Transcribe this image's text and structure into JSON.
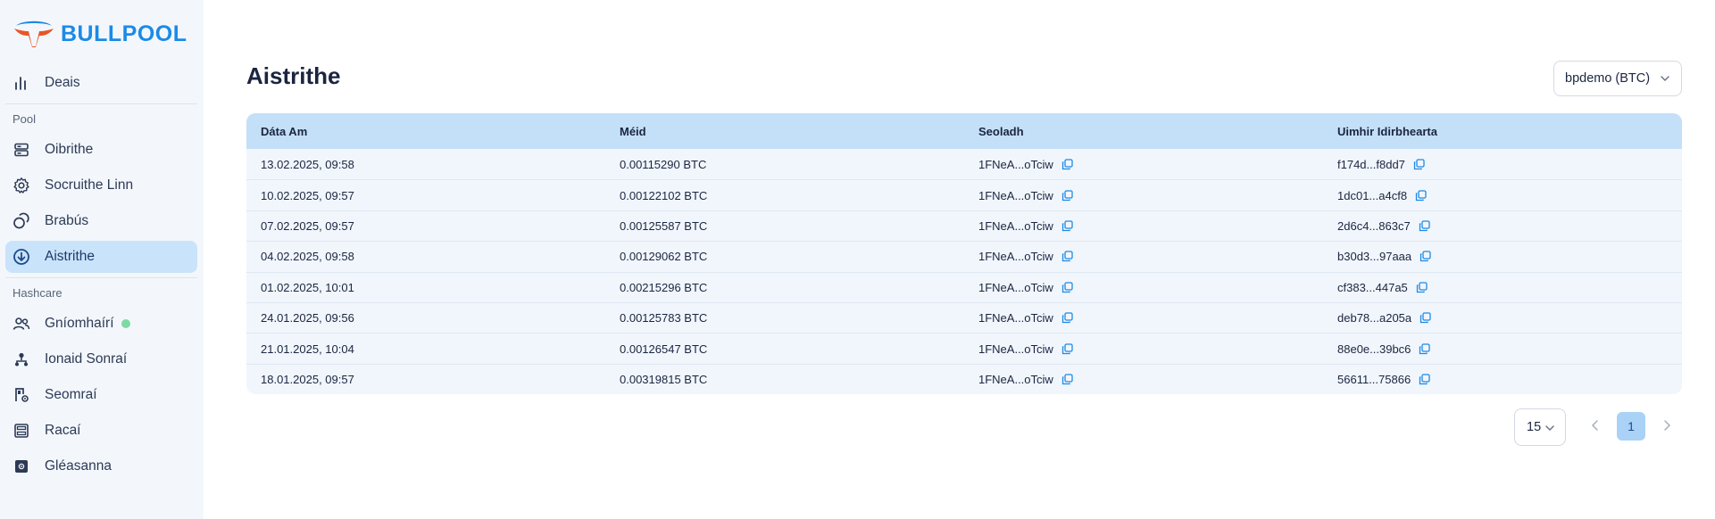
{
  "brand": {
    "name": "BULLPOOL"
  },
  "sidebar": {
    "top_item": {
      "label": "Deais",
      "icon": "bar-chart-icon"
    },
    "sections": [
      {
        "label": "Pool",
        "items": [
          {
            "label": "Oibrithe",
            "icon": "server-icon"
          },
          {
            "label": "Socruithe Linn",
            "icon": "gear-icon"
          },
          {
            "label": "Brabús",
            "icon": "coins-icon"
          },
          {
            "label": "Aistrithe",
            "icon": "arrow-down-circle-icon",
            "active": true
          }
        ]
      },
      {
        "label": "Hashcare",
        "items": [
          {
            "label": "Gníomhaírí",
            "icon": "users-icon",
            "status": "online"
          },
          {
            "label": "Ionaid Sonraí",
            "icon": "network-icon"
          },
          {
            "label": "Seomraí",
            "icon": "room-settings-icon"
          },
          {
            "label": "Racaí",
            "icon": "rack-icon"
          },
          {
            "label": "Gléasanna",
            "icon": "chip-icon"
          }
        ]
      }
    ]
  },
  "main": {
    "title": "Aistrithe",
    "account_selector": "bpdemo (BTC)",
    "table": {
      "columns": [
        "Dáta Am",
        "Méid",
        "Seoladh",
        "Uimhir Idirbhearta"
      ],
      "rows": [
        {
          "date": "13.02.2025, 09:58",
          "amount": "0.00115290 BTC",
          "address": "1FNeA...oTciw",
          "txid": "f174d...f8dd7"
        },
        {
          "date": "10.02.2025, 09:57",
          "amount": "0.00122102 BTC",
          "address": "1FNeA...oTciw",
          "txid": "1dc01...a4cf8"
        },
        {
          "date": "07.02.2025, 09:57",
          "amount": "0.00125587 BTC",
          "address": "1FNeA...oTciw",
          "txid": "2d6c4...863c7"
        },
        {
          "date": "04.02.2025, 09:58",
          "amount": "0.00129062 BTC",
          "address": "1FNeA...oTciw",
          "txid": "b30d3...97aaa"
        },
        {
          "date": "01.02.2025, 10:01",
          "amount": "0.00215296 BTC",
          "address": "1FNeA...oTciw",
          "txid": "cf383...447a5"
        },
        {
          "date": "24.01.2025, 09:56",
          "amount": "0.00125783 BTC",
          "address": "1FNeA...oTciw",
          "txid": "deb78...a205a"
        },
        {
          "date": "21.01.2025, 10:04",
          "amount": "0.00126547 BTC",
          "address": "1FNeA...oTciw",
          "txid": "88e0e...39bc6"
        },
        {
          "date": "18.01.2025, 09:57",
          "amount": "0.00319815 BTC",
          "address": "1FNeA...oTciw",
          "txid": "56611...75866"
        }
      ]
    },
    "pagination": {
      "page_size": "15",
      "current_page": "1"
    }
  },
  "colors": {
    "accent": "#1c8ae6",
    "active_bg": "#c9e3fa",
    "header_bg": "#c4e0f9",
    "online": "#7ed9a3"
  }
}
